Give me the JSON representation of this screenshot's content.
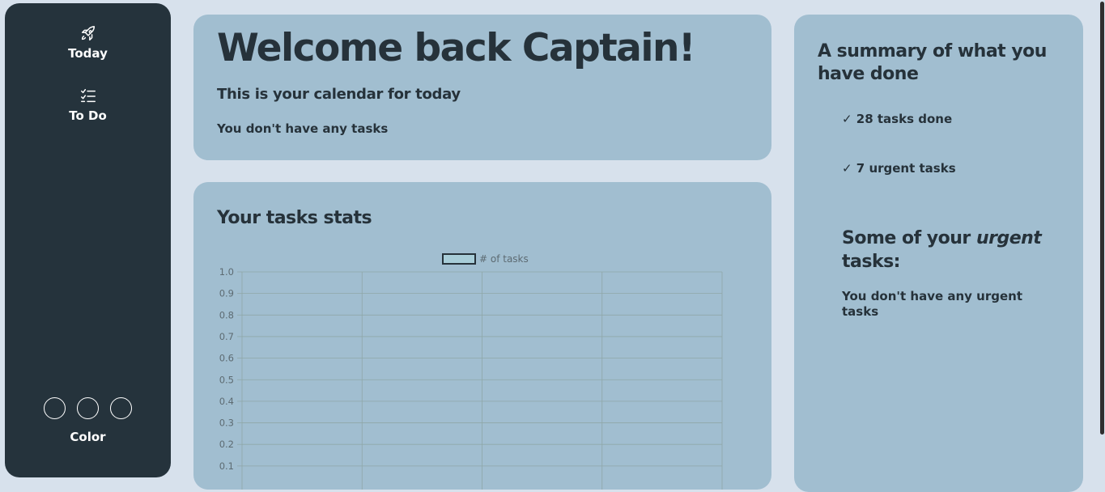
{
  "sidebar": {
    "today_label": "Today",
    "todo_label": "To Do",
    "color_label": "Color",
    "swatch_count": 3
  },
  "welcome": {
    "title": "Welcome back Captain!",
    "subtitle": "This is your calendar for today",
    "empty_text": "You don't have any tasks"
  },
  "stats": {
    "title": "Your tasks stats"
  },
  "summary": {
    "title": "A summary of what you have done",
    "tasks_done": "✓ 28 tasks done",
    "urgent_tasks": "✓ 7 urgent tasks",
    "urgent_heading_pre": "Some of your ",
    "urgent_heading_em": "urgent",
    "urgent_heading_post": " tasks:",
    "urgent_empty": "You don't have any urgent tasks"
  },
  "colors": {
    "background": "#d7e1ec",
    "sidebar": "#25333c",
    "card": "#a1bed0",
    "text": "#26323a"
  },
  "chart_data": {
    "type": "bar",
    "legend": [
      "# of tasks"
    ],
    "legend_position": "top",
    "series": [
      {
        "name": "# of tasks",
        "values": []
      }
    ],
    "categories": [],
    "yticks": [
      "0.1",
      "0.2",
      "0.3",
      "0.4",
      "0.5",
      "0.6",
      "0.7",
      "0.8",
      "0.9",
      "1.0"
    ],
    "ylim": [
      0,
      1
    ],
    "grid": true
  }
}
